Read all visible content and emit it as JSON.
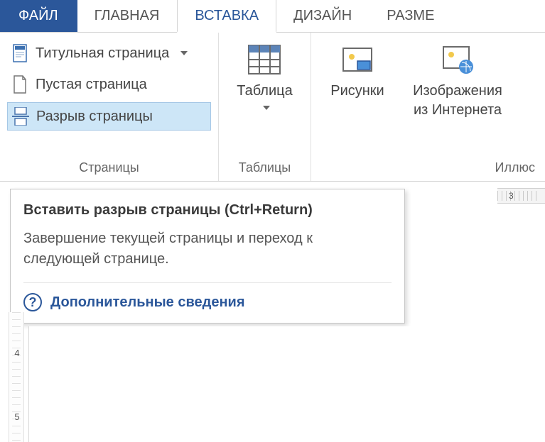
{
  "tabs": {
    "file": "ФАЙЛ",
    "home": "ГЛАВНАЯ",
    "insert": "ВСТАВКА",
    "design": "ДИЗАЙН",
    "layout": "РАЗМЕ"
  },
  "groups": {
    "pages": {
      "label": "Страницы",
      "title_page": "Титульная страница",
      "blank_page": "Пустая страница",
      "page_break": "Разрыв страницы"
    },
    "tables": {
      "label": "Таблицы",
      "table_btn": "Таблица"
    },
    "illustrations": {
      "label": "Иллюс",
      "pictures": "Рисунки",
      "online_l1": "Изображения",
      "online_l2": "из Интернета"
    }
  },
  "tooltip": {
    "title": "Вставить разрыв страницы (Ctrl+Return)",
    "desc": "Завершение текущей страницы и переход к следующей странице.",
    "help": "Дополнительные сведения"
  },
  "ruler": {
    "h_marker": "3",
    "v_marks": [
      "4",
      "5"
    ]
  }
}
